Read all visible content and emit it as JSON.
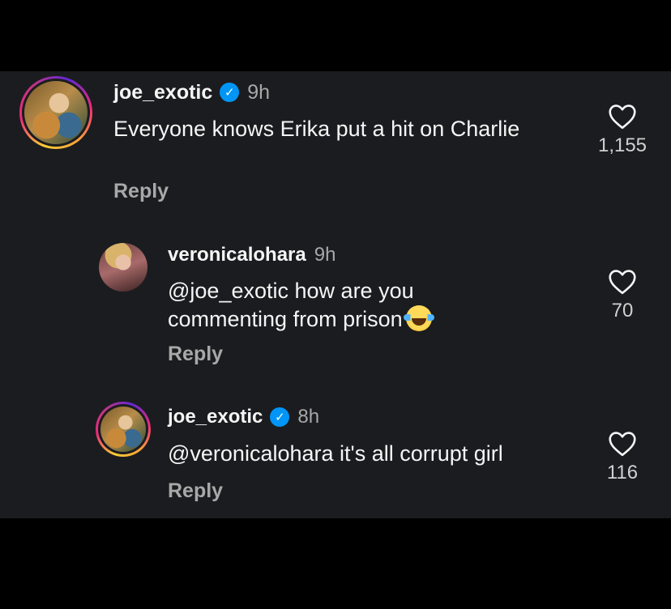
{
  "comments": [
    {
      "username": "joe_exotic",
      "verified": true,
      "time": "9h",
      "text": "Everyone knows Erika put a hit on Charlie",
      "reply_label": "Reply",
      "likes": "1,155"
    },
    {
      "username": "veronicalohara",
      "verified": false,
      "time": "9h",
      "mention": "@joe_exotic",
      "text": "how are you commenting from prison",
      "reply_label": "Reply",
      "likes": "70"
    },
    {
      "username": "joe_exotic",
      "verified": true,
      "time": "8h",
      "mention": "@veronicalohara",
      "text": "it's all corrupt girl",
      "reply_label": "Reply",
      "likes": "116"
    }
  ],
  "icons": {
    "verified": "verified-badge-icon",
    "like": "heart-outline-icon",
    "emoji": "tears-of-joy-emoji"
  },
  "colors": {
    "background": "#000000",
    "panel": "#1b1c1f",
    "text": "#f5f5f5",
    "muted": "#a8a8a8",
    "verified": "#0095f6"
  }
}
